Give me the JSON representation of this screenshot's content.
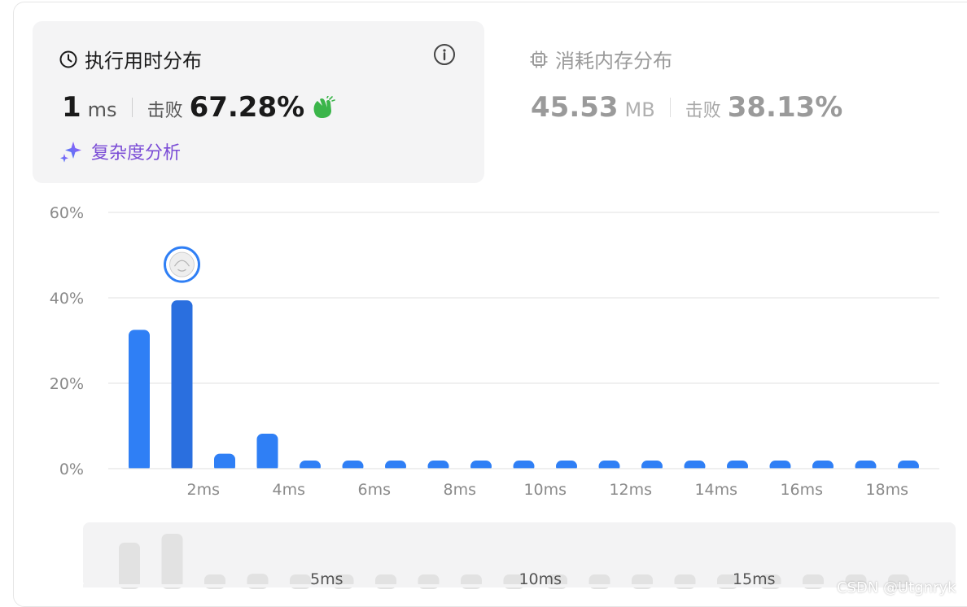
{
  "runtime_tab": {
    "title": "执行用时分布",
    "value": "1",
    "unit": "ms",
    "beat_label": "击败",
    "beat_pct": "67.28%",
    "complexity_link": "复杂度分析"
  },
  "memory_tab": {
    "title": "消耗内存分布",
    "value": "45.53",
    "unit": "MB",
    "beat_label": "击败",
    "beat_pct": "38.13%"
  },
  "icons": {
    "runtime": "clock-icon",
    "info": "info-icon",
    "clap": "clapping-hands-icon",
    "complexity": "sparkle-icon",
    "memory": "chip-icon",
    "marker": "avatar"
  },
  "colors": {
    "bar": "#2f7ff5",
    "bar_highlight": "#2a6fdf",
    "nav_bar": "#e2e2e2",
    "grid": "#e8e8e8"
  },
  "chart_data": {
    "type": "bar",
    "y_ticks": [
      "60%",
      "40%",
      "20%",
      "0%"
    ],
    "ylim": [
      0,
      60
    ],
    "x_tick_labels": [
      {
        "index": 2,
        "label": "2ms"
      },
      {
        "index": 4,
        "label": "4ms"
      },
      {
        "index": 6,
        "label": "6ms"
      },
      {
        "index": 8,
        "label": "8ms"
      },
      {
        "index": 10,
        "label": "10ms"
      },
      {
        "index": 12,
        "label": "12ms"
      },
      {
        "index": 14,
        "label": "14ms"
      },
      {
        "index": 16,
        "label": "16ms"
      },
      {
        "index": 18,
        "label": "18ms"
      }
    ],
    "x": [
      0,
      1,
      2,
      3,
      4,
      5,
      6,
      7,
      8,
      9,
      10,
      11,
      12,
      13,
      14,
      15,
      16,
      17,
      18
    ],
    "values": [
      32.5,
      39.4,
      3.5,
      8.2,
      1.9,
      1.9,
      1.9,
      1.9,
      1.9,
      1.9,
      1.9,
      1.9,
      1.9,
      1.9,
      1.9,
      1.9,
      1.9,
      1.9,
      1.9
    ],
    "highlight_index": 1,
    "navigator": {
      "values": [
        32.5,
        39.4,
        3.5,
        8.2,
        1.9,
        1.9,
        1.9,
        1.9,
        1.9,
        1.9,
        1.9,
        1.9,
        1.9,
        1.9,
        1.9,
        1.9,
        1.9,
        1.9,
        1.9
      ],
      "tick_labels": [
        {
          "index": 5,
          "label": "5ms"
        },
        {
          "index": 10,
          "label": "10ms"
        },
        {
          "index": 15,
          "label": "15ms"
        }
      ]
    }
  },
  "watermark": "CSDN @Utgnryk"
}
